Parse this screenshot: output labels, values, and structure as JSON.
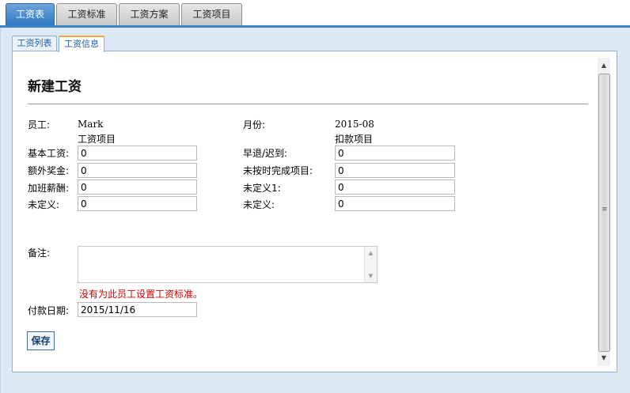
{
  "top_tabs": [
    {
      "label": "工资表",
      "active": true
    },
    {
      "label": "工资标准",
      "active": false
    },
    {
      "label": "工资方案",
      "active": false
    },
    {
      "label": "工资项目",
      "active": false
    }
  ],
  "sub_tabs": [
    {
      "label": "工资列表",
      "active": false
    },
    {
      "label": "工资信息",
      "active": true
    }
  ],
  "form": {
    "title": "新建工资",
    "employee_label": "员工:",
    "employee_value": "Mark",
    "month_label": "月份:",
    "month_value": "2015-08",
    "salary_items_header": "工资项目",
    "deduction_items_header": "扣款项目",
    "left_fields": [
      {
        "label": "基本工资:",
        "value": "0"
      },
      {
        "label": "额外奖金:",
        "value": "0"
      },
      {
        "label": "加班薪酬:",
        "value": "0"
      },
      {
        "label": "未定义:",
        "value": "0"
      }
    ],
    "right_fields": [
      {
        "label": "早退/迟到:",
        "value": "0"
      },
      {
        "label": "未按时完成项目:",
        "value": "0"
      },
      {
        "label": "未定义1:",
        "value": "0"
      },
      {
        "label": "未定义:",
        "value": "0"
      }
    ],
    "remark_label": "备注:",
    "remark_value": "",
    "error_message": "没有为此员工设置工资标准。",
    "pay_date_label": "付款日期:",
    "pay_date_value": "2015/11/16",
    "save_label": "保存"
  }
}
